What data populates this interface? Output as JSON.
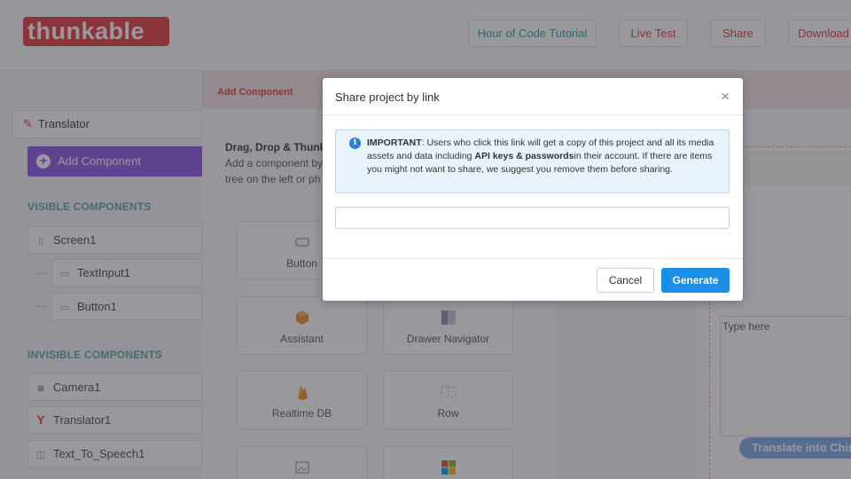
{
  "topbar": {
    "logo_text": "thunkable",
    "buttons": [
      "Hour of Code Tutorial",
      "Live Test",
      "Share",
      "Download"
    ]
  },
  "sidebar": {
    "project_name": "Translator",
    "add_component_label": "Add Component",
    "visible_heading": "VISIBLE COMPONENTS",
    "visible_items": [
      "Screen1",
      "TextInput1",
      "Button1"
    ],
    "invisible_heading": "INVISIBLE COMPONENTS",
    "invisible_items": [
      "Camera1",
      "Translator1",
      "Text_To_Speech1"
    ]
  },
  "center": {
    "header_label": "Add Component",
    "drag_title": "Drag, Drop & Thunk",
    "drag_line1": "Add a component by",
    "drag_line2": "tree on the left or ph",
    "tiles": [
      "Button",
      "Assistant",
      "Drawer Navigator",
      "Realtime DB",
      "Row"
    ]
  },
  "preview": {
    "input_placeholder": "Type here",
    "button_label": "Translate into Chin"
  },
  "modal": {
    "title": "Share project by link",
    "close_glyph": "×",
    "alert_important": "IMPORTANT",
    "alert_text_1": ": Users who click this link will get a copy of this project and all its media assets and data including ",
    "alert_bold": "API keys & passwords",
    "alert_text_2": "in their account. If there are items you might not want to share, we suggest you remove them before sharing.",
    "link_value": "",
    "cancel_label": "Cancel",
    "generate_label": "Generate"
  },
  "colors": {
    "brand_red": "#e5383b",
    "purple": "#8c55e6",
    "teal": "#27a19a",
    "primary_blue": "#1b8fe6",
    "info_bg": "#e8f3fd"
  }
}
